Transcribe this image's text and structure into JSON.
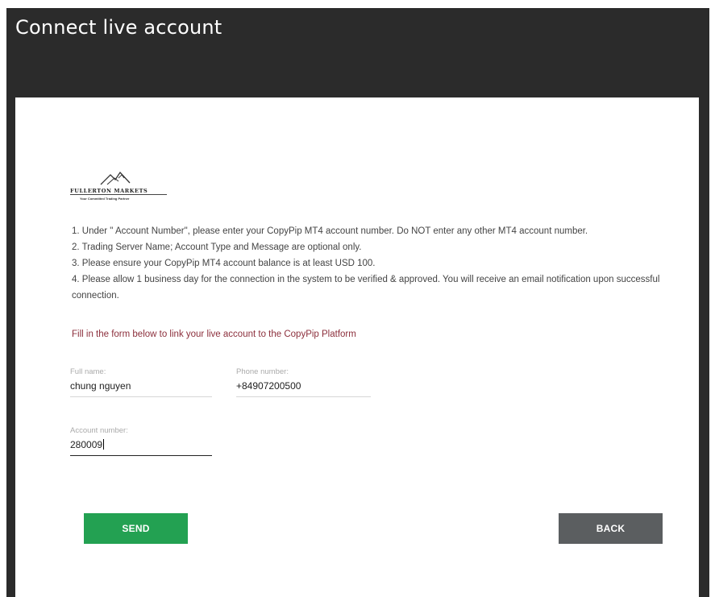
{
  "window": {
    "title": "Connect live account"
  },
  "logo": {
    "brand": "FULLERTON MARKETS",
    "tagline": "Your Committed Trading Partner"
  },
  "instructions": [
    "1. Under \" Account Number\", please enter your CopyPip MT4 account number. Do NOT enter any other MT4 account number.",
    "2. Trading Server Name; Account Type and Message are optional only.",
    "3. Please ensure your CopyPip MT4 account balance is at least USD 100.",
    "4. Please allow 1 business day for the connection in the system to be verified & approved. You will receive an email notification upon successful connection."
  ],
  "notice": "Fill in the form below to link your live account to the CopyPip Platform",
  "form": {
    "full_name": {
      "label": "Full name:",
      "value": "chung nguyen"
    },
    "phone": {
      "label": "Phone number:",
      "value": "+84907200500"
    },
    "account": {
      "label": "Account number:",
      "value": "280009"
    }
  },
  "buttons": {
    "send": "SEND",
    "back": "BACK"
  },
  "colors": {
    "header_bg": "#2b2b2b",
    "send_bg": "#23a152",
    "back_bg": "#5b5e60",
    "notice_text": "#8c2f3c"
  }
}
